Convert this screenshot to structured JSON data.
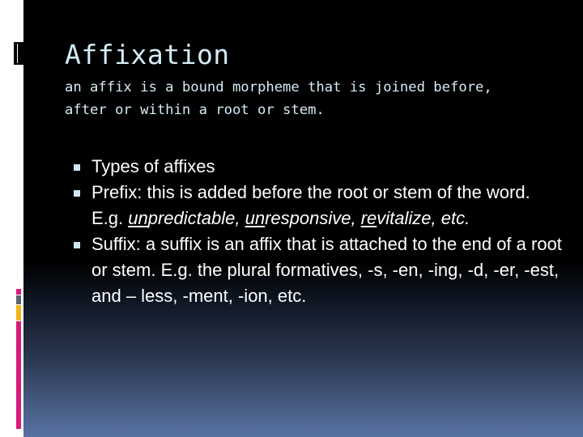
{
  "slide": {
    "title": "Affixation",
    "subtitle": "an affix is a bound morpheme that is joined before, after or within a root or stem.",
    "bullets": [
      {
        "text": "Types of affixes"
      },
      {
        "text_before": "Prefix: this is added before the root or stem of the word. E.g. ",
        "examples": [
          {
            "prefix": "un",
            "rest": "predictable"
          },
          {
            "prefix": "un",
            "rest": "responsive"
          },
          {
            "prefix": "re",
            "rest": "vitalize"
          }
        ],
        "separator": ", ",
        "text_after": ", etc."
      },
      {
        "text": "Suffix: a suffix is an affix that is attached to the end of a root or stem. E.g. the plural formatives, -s, -en, -ing, -d, -er, -est, and – less, -ment, -ion, etc."
      }
    ]
  },
  "colors": {
    "title": "#d4ecf7",
    "body_text": "#ffffff",
    "bullet": "#cfe6f4",
    "accent_pink": "#d81b79",
    "accent_gray": "#5b6470",
    "accent_orange": "#f4b21a",
    "gradient_bottom": "#5872a2"
  }
}
